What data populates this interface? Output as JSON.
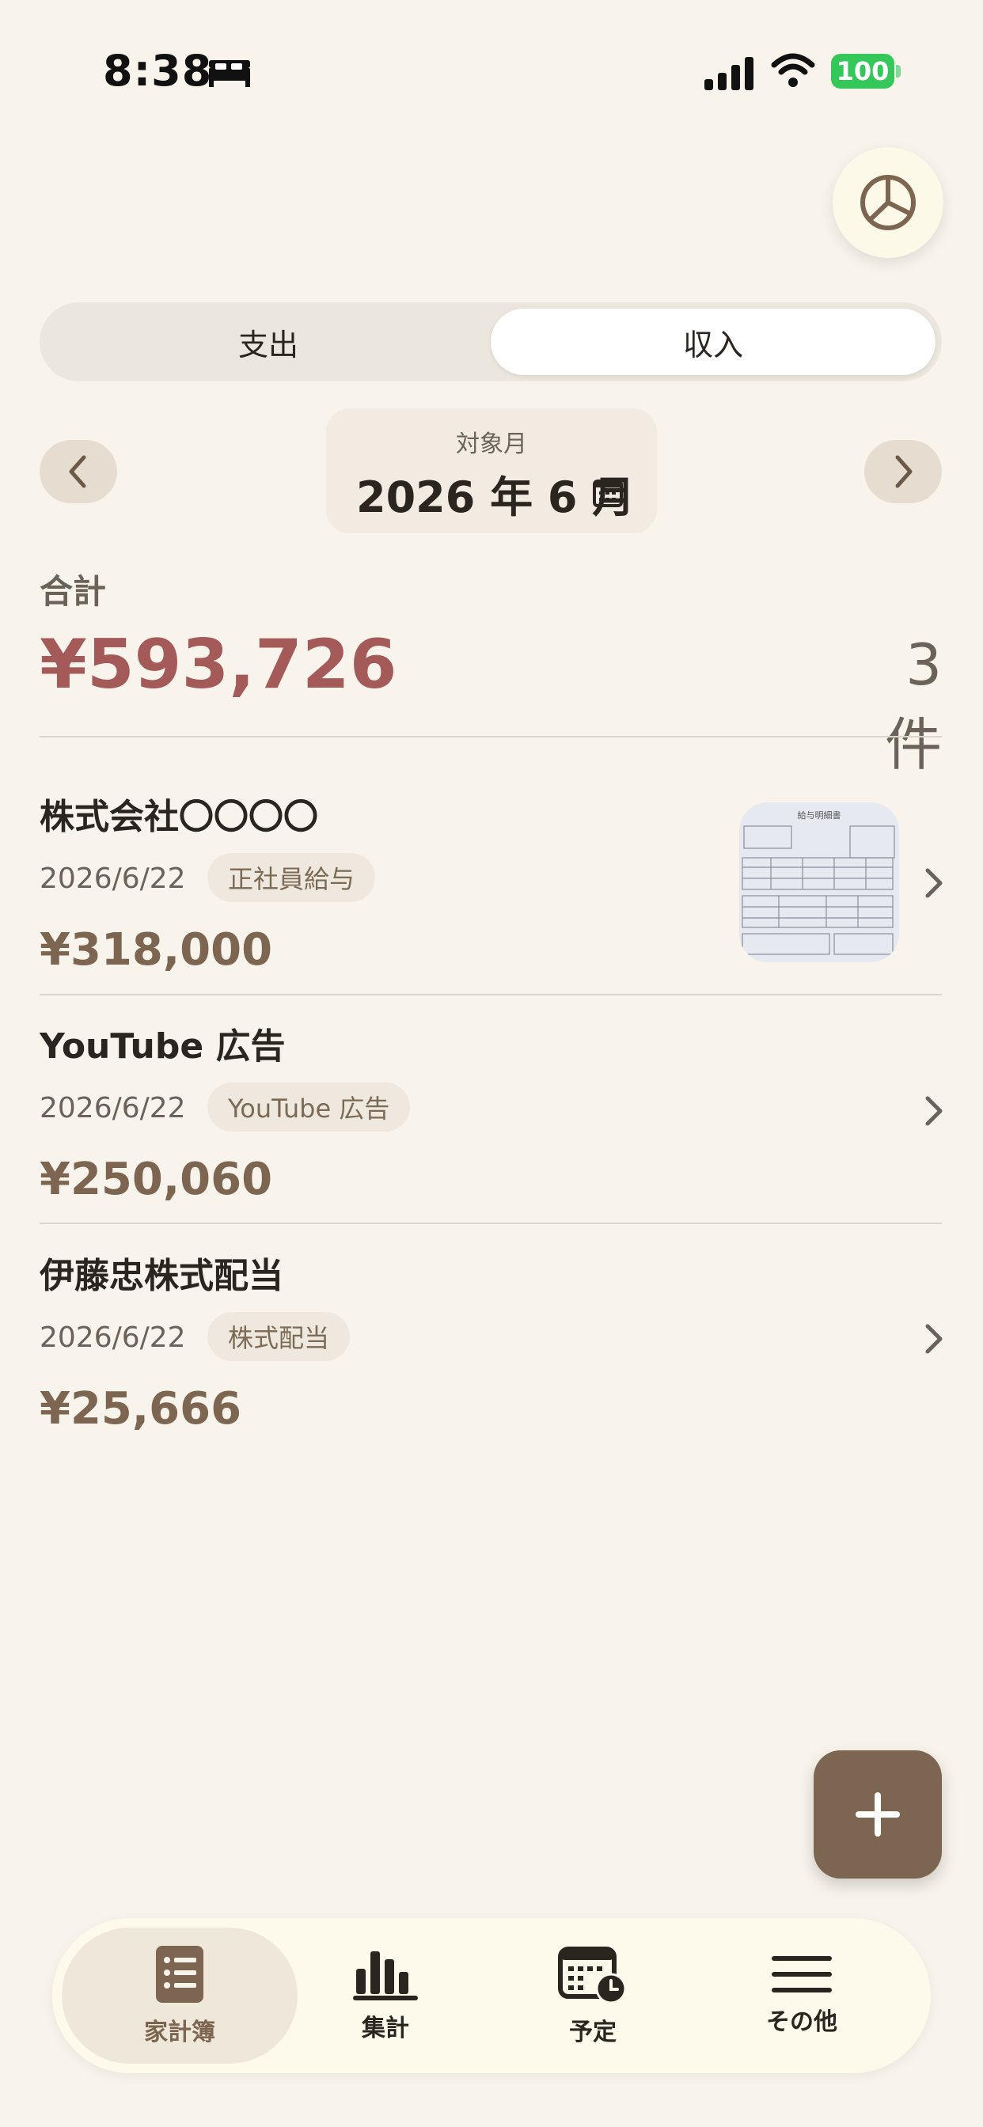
{
  "status_bar": {
    "time": "8:38",
    "battery": "100"
  },
  "segment": {
    "expense": "支出",
    "income": "収入",
    "selected": "income"
  },
  "month": {
    "label": "対象月",
    "value": "2026 年 6 月"
  },
  "total": {
    "label": "合計",
    "amount": "¥593,726",
    "count": "3 件"
  },
  "entries": [
    {
      "name": "株式会社〇〇〇〇",
      "date": "2026/6/22",
      "category": "正社員給与",
      "amount": "¥318,000",
      "has_receipt": true
    },
    {
      "name": "YouTube 広告",
      "date": "2026/6/22",
      "category": "YouTube 広告",
      "amount": "¥250,060",
      "has_receipt": false
    },
    {
      "name": "伊藤忠株式配当",
      "date": "2026/6/22",
      "category": "株式配当",
      "amount": "¥25,666",
      "has_receipt": false
    }
  ],
  "receipt": {
    "title": "給与明細書"
  },
  "tabs": [
    {
      "label": "家計簿",
      "icon": "book-list-icon",
      "active": true
    },
    {
      "label": "集計",
      "icon": "bar-chart-icon",
      "active": false
    },
    {
      "label": "予定",
      "icon": "calendar-clock-icon",
      "active": false
    },
    {
      "label": "その他",
      "icon": "menu-icon",
      "active": false
    }
  ],
  "colors": {
    "background": "#f8f4ec",
    "accent": "#7c6651",
    "total": "#a55a5a",
    "battery": "#34c759"
  }
}
